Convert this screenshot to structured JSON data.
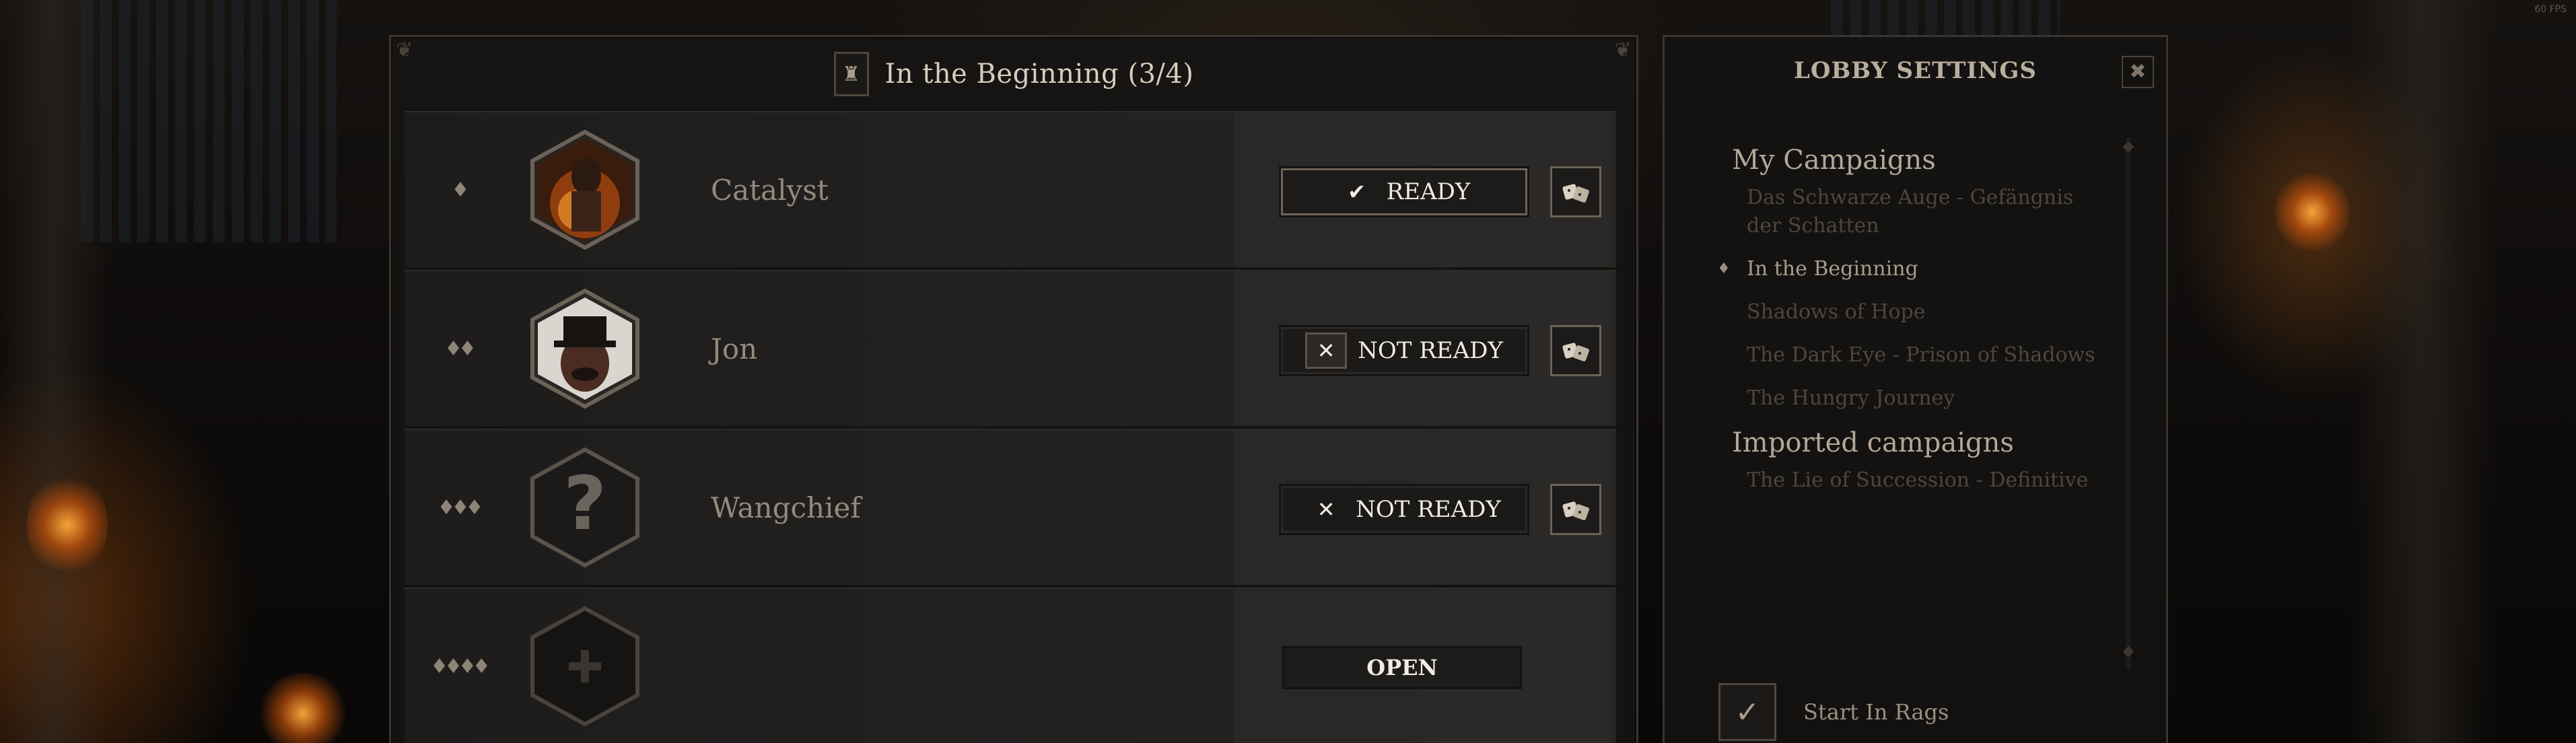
{
  "top_right_text": "60 FPS",
  "party": {
    "title": "In the Beginning  (3/4)",
    "header_icon": "tower-icon",
    "players": [
      {
        "slot_marker": "♦",
        "name": "Catalyst",
        "portrait": "fire-mage-portrait",
        "status": "READY",
        "status_glyph": "✔",
        "has_dice": true
      },
      {
        "slot_marker": "♦♦",
        "name": "Jon",
        "portrait": "top-hat-portrait",
        "status": "NOT READY",
        "status_glyph": "✕",
        "has_dice": true
      },
      {
        "slot_marker": "♦♦♦",
        "name": "Wangchief",
        "portrait": "unknown-portrait",
        "status": "NOT READY",
        "status_glyph": "✕",
        "has_dice": true
      },
      {
        "slot_marker": "♦♦♦♦",
        "name": "",
        "portrait": "empty-slot-portrait",
        "status": "OPEN",
        "status_glyph": "",
        "has_dice": false
      }
    ]
  },
  "lobby": {
    "title": "LOBBY SETTINGS",
    "close_glyph": "✖",
    "groups": [
      {
        "title": "My Campaigns",
        "items": [
          {
            "label": "Das Schwarze Auge  - Gefängnis der Schatten",
            "selected": false
          },
          {
            "label": "In the Beginning",
            "selected": true
          },
          {
            "label": "Shadows of Hope",
            "selected": false
          },
          {
            "label": "The Dark Eye - Prison of Shadows",
            "selected": false
          },
          {
            "label": "The Hungry Journey",
            "selected": false
          }
        ]
      },
      {
        "title": "Imported campaigns",
        "items": [
          {
            "label": "The Lie of Succession -  Definitive",
            "selected": false
          }
        ]
      }
    ],
    "start_in_rags": {
      "label": "Start In Rags",
      "checked": true,
      "glyph": "✓"
    }
  },
  "colors": {
    "accent_text": "#d8cdbc",
    "muted_text": "#948a7c",
    "panel_bg": "#161413"
  }
}
